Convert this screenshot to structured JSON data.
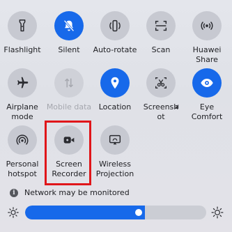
{
  "tiles": [
    {
      "label": "Flashlight",
      "icon": "flashlight-icon",
      "state": "off"
    },
    {
      "label": "Silent",
      "icon": "bell-off-icon",
      "state": "on"
    },
    {
      "label": "Auto-rotate",
      "icon": "auto-rotate-icon",
      "state": "off"
    },
    {
      "label": "Scan",
      "icon": "scan-icon",
      "state": "off"
    },
    {
      "label": "Huawei\nShare",
      "icon": "huawei-share-icon",
      "state": "off"
    },
    {
      "label": "Airplane\nmode",
      "icon": "airplane-icon",
      "state": "off"
    },
    {
      "label": "Mobile data",
      "icon": "mobile-data-icon",
      "state": "disabled"
    },
    {
      "label": "Location",
      "icon": "location-pin-icon",
      "state": "on"
    },
    {
      "label": "Screensh\not",
      "icon": "screenshot-icon",
      "state": "off"
    },
    {
      "label": "Eye\nComfort",
      "icon": "eye-icon",
      "state": "on"
    },
    {
      "label": "Personal\nhotspot",
      "icon": "hotspot-icon",
      "state": "off"
    },
    {
      "label": "Screen\nRecorder",
      "icon": "screen-recorder-icon",
      "state": "off"
    },
    {
      "label": "Wireless\nProjection",
      "icon": "wireless-projection-icon",
      "state": "off"
    }
  ],
  "notice": {
    "text": "Network may be monitored",
    "icon": "info-icon"
  },
  "brightness": {
    "level": 0.66,
    "low_icon": "sun-small-icon",
    "high_icon": "sun-large-icon"
  },
  "highlighted_tile": "Screen Recorder",
  "colors": {
    "accent": "#1769ea",
    "tile_off": "#c7c9d1",
    "highlight": "#e0161a"
  }
}
